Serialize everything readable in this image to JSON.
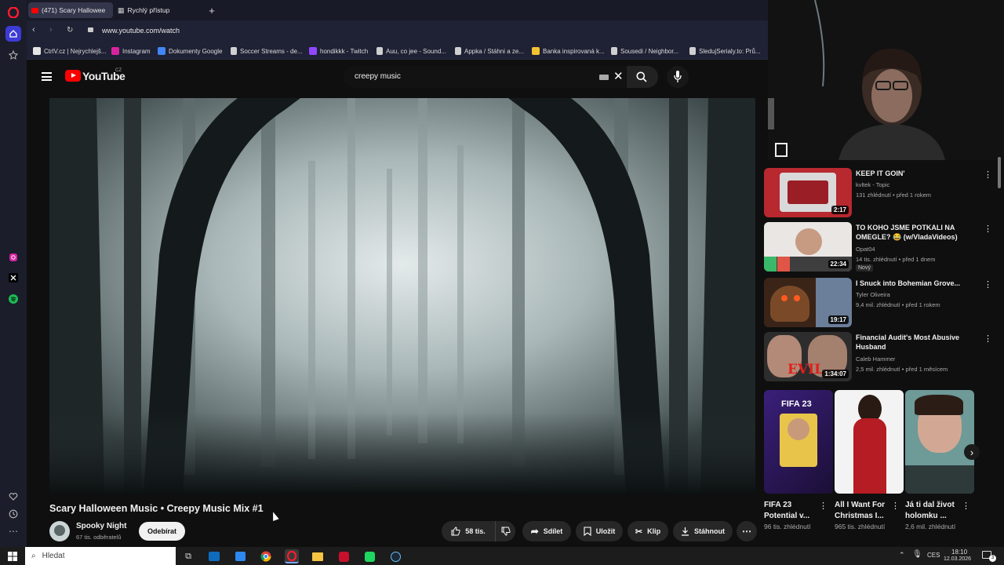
{
  "browser": {
    "tabs": [
      {
        "label": "(471) Scary Hallowee",
        "active": true
      },
      {
        "label": "Rychlý přístup",
        "active": false
      }
    ],
    "url": "www.youtube.com/watch",
    "bookmarks": [
      {
        "label": "CtrlV.cz | Nejrychlejš...",
        "color": "#e5e5e5"
      },
      {
        "label": "Instagram",
        "color": "#d6249f"
      },
      {
        "label": "Dokumenty Google",
        "color": "#4285f4"
      },
      {
        "label": "Soccer Streams - de...",
        "color": "#cfcfcf"
      },
      {
        "label": "hondikkk - Twitch",
        "color": "#9146ff"
      },
      {
        "label": "Auu, co jee - Sound...",
        "color": "#cfcfcf"
      },
      {
        "label": "Appka / Stáhni a ze...",
        "color": "#cfcfcf"
      },
      {
        "label": "Banka inspirovaná k...",
        "color": "#f2c230"
      },
      {
        "label": "Sousedi / Neighbor...",
        "color": "#cfcfcf"
      },
      {
        "label": "SledujSerialy.to: Prů...",
        "color": "#cfcfcf"
      }
    ]
  },
  "youtube": {
    "logo_text": "YouTube",
    "country": "CZ",
    "search_query": "creepy music",
    "video": {
      "title": "Scary Halloween Music • Creepy Music Mix #1",
      "channel": "Spooky Night",
      "subscribers": "67 tis. odběratelů",
      "subscribe_label": "Odebírat",
      "likes": "58 tis.",
      "share_label": "Sdílet",
      "save_label": "Uložit",
      "clip_label": "Klip",
      "download_label": "Stáhnout"
    },
    "recommendations": [
      {
        "title": "KEEP IT GOIN'",
        "channel": "kvltek - Topic",
        "meta": "131 zhlédnutí • před 1 rokem",
        "duration": "2:17",
        "badge": ""
      },
      {
        "title": "TO KOHO JSME POTKALI NA OMEGLE? 😂 (w/VladaVideos)",
        "channel": "Opat04",
        "meta": "14 tis. zhlédnutí • před 1 dnem",
        "duration": "22:34",
        "badge": "Nový"
      },
      {
        "title": "I Snuck into Bohemian Grove...",
        "channel": "Tyler Oliveira",
        "meta": "9,4 mil. zhlédnutí • před 1 rokem",
        "duration": "19:17",
        "badge": ""
      },
      {
        "title": "Financial Audit's Most Abusive Husband",
        "channel": "Caleb Hammer",
        "meta": "2,5 mil. zhlédnutí • před 1 měsícem",
        "duration": "1:34:07",
        "badge": ""
      }
    ],
    "shorts": [
      {
        "title": "FIFA 23 Potential v...",
        "views": "96 tis. zhlédnutí",
        "thumb_text": "FIFA 23"
      },
      {
        "title": "All I Want For Christmas I...",
        "views": "965 tis. zhlédnutí",
        "thumb_text": ""
      },
      {
        "title": "Já ti dal život holomku ...",
        "views": "2,6 mil. zhlédnutí",
        "thumb_text": ""
      }
    ]
  },
  "taskbar": {
    "search_placeholder": "Hledat",
    "language": "CES",
    "time": "18:10",
    "date": "12.03.2026",
    "notifications": "3"
  }
}
